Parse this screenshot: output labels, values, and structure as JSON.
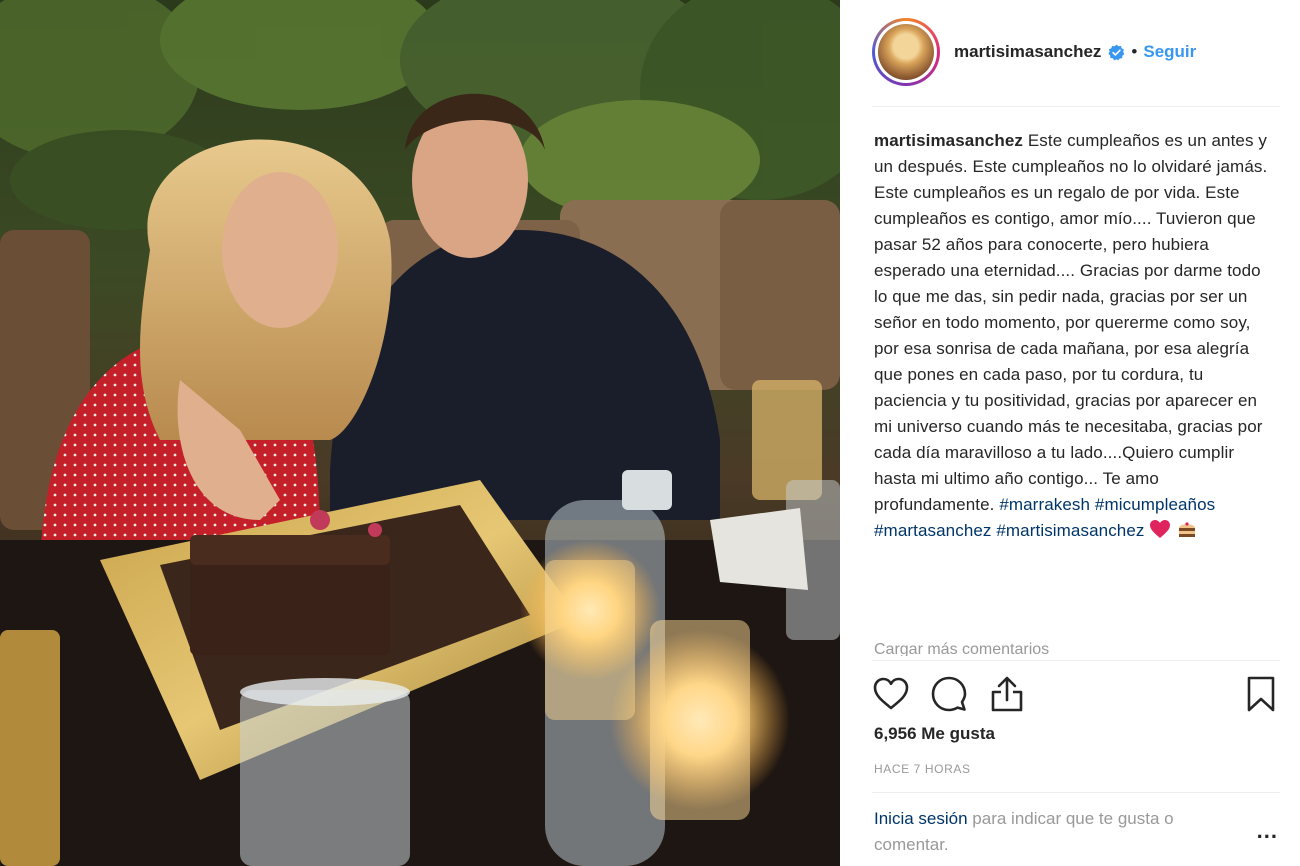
{
  "post": {
    "username": "martisimasanchez",
    "separator": "•",
    "follow_label": "Seguir",
    "caption_user": "martisimasanchez",
    "caption_text": "Este cumpleaños es un antes y un después. Este cumpleaños no lo olvidaré jamás. Este cumpleaños es un regalo de por vida. Este cumpleaños es contigo, amor mío.... Tuvieron que pasar 52 años para conocerte, pero hubiera esperado una eternidad.... Gracias por darme todo lo que me das, sin pedir nada, gracias por ser un señor en todo momento, por quererme como soy, por esa sonrisa de cada mañana, por esa alegría que pones en cada paso, por tu cordura, tu paciencia y tu positividad, gracias por aparecer en mi universo cuando más te necesitaba, gracias por cada día maravilloso a tu lado....Quiero cumplir hasta mi ultimo año contigo... Te amo profundamente.",
    "hashtags": [
      "#marrakesh",
      "#micumpleaños",
      "#martasanchez",
      "#martisimasanchez"
    ],
    "caption_emojis": [
      "heart",
      "cake"
    ],
    "load_more": "Cargar más comentarios",
    "likes": "6,956 Me gusta",
    "timestamp": "HACE 7 HORAS",
    "login_link": "Inicia sesión",
    "login_text": "para indicar que te gusta o comentar.",
    "more_label": "..."
  },
  "icons": {
    "verified": "verified-badge-icon",
    "like": "heart-outline-icon",
    "comment": "speech-bubble-icon",
    "share": "share-upload-icon",
    "save": "bookmark-icon"
  },
  "colors": {
    "link_blue": "#3897f0",
    "hashtag": "#003569",
    "muted": "#999999",
    "text": "#262626",
    "heart_emoji": "#e0245e"
  }
}
